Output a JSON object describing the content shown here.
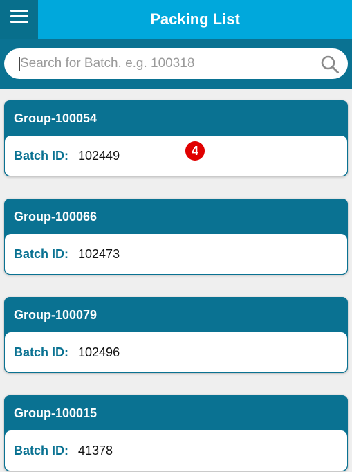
{
  "header": {
    "title": "Packing List",
    "menu_icon": "hamburger-menu-icon"
  },
  "search": {
    "placeholder": "Search for Batch. e.g. 100318",
    "value": "",
    "icon": "search-icon"
  },
  "groups": [
    {
      "group": "Group-100054",
      "batch_label": "Batch ID:",
      "batch_id": "102449"
    },
    {
      "group": "Group-100066",
      "batch_label": "Batch ID:",
      "batch_id": "102473"
    },
    {
      "group": "Group-100079",
      "batch_label": "Batch ID:",
      "batch_id": "102496"
    },
    {
      "group": "Group-100015",
      "batch_label": "Batch ID:",
      "batch_id": "41378"
    }
  ],
  "badge": {
    "value": "4"
  },
  "colors": {
    "header": "#00a8dc",
    "menu_button": "#086f8c",
    "card_header": "#0a7292",
    "batch_label": "#0a7292",
    "badge": "#e00000",
    "background": "#efefef"
  }
}
